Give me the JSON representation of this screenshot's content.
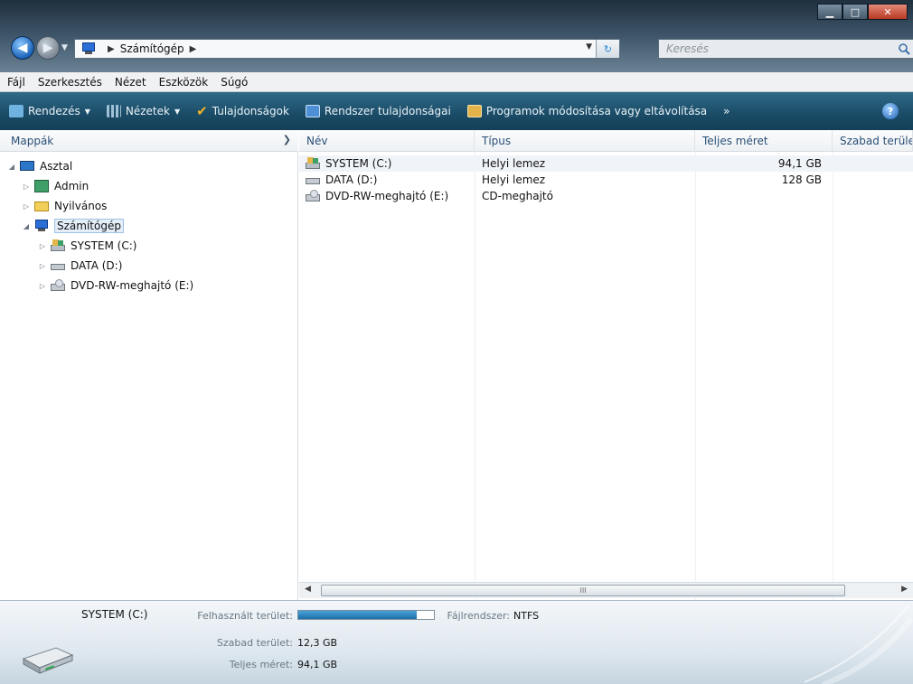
{
  "window": {
    "caption_min": "▁",
    "caption_max": "□",
    "caption_close": "✕"
  },
  "nav": {
    "back": "◀",
    "forward": "▶",
    "address_segments": [
      "Számítógép"
    ],
    "search_placeholder": "Keresés"
  },
  "menu": [
    "Fájl",
    "Szerkesztés",
    "Nézet",
    "Eszközök",
    "Súgó"
  ],
  "commands": [
    {
      "label": "Rendezés",
      "icon": "organize-icon",
      "color": "#6fb3e0",
      "dropdown": true
    },
    {
      "label": "Nézetek",
      "icon": "views-icon",
      "color": "#9fc0d6",
      "dropdown": true
    },
    {
      "label": "Tulajdonságok",
      "icon": "check-icon",
      "color": "#f2b428",
      "dropdown": false
    },
    {
      "label": "Rendszer tulajdonságai",
      "icon": "system-properties-icon",
      "color": "#4f8fd6",
      "dropdown": false
    },
    {
      "label": "Programok módosítása vagy eltávolítása",
      "icon": "programs-icon",
      "color": "#e4b24a",
      "dropdown": false
    }
  ],
  "more_chevron": "»",
  "help": "?",
  "navpane": {
    "title": "Mappák",
    "items": [
      {
        "label": "Asztal",
        "icon": "desktop-icon",
        "arrow": "◢",
        "level": 0
      },
      {
        "label": "Admin",
        "icon": "user-folder-icon",
        "arrow": "▷",
        "level": 1
      },
      {
        "label": "Nyilvános",
        "icon": "folder-icon",
        "arrow": "▷",
        "level": 1
      },
      {
        "label": "Számítógép",
        "icon": "computer-icon",
        "arrow": "◢",
        "level": 1,
        "selected": true
      },
      {
        "label": "SYSTEM (C:)",
        "icon": "system-drive-icon",
        "arrow": "▷",
        "level": 2
      },
      {
        "label": "DATA (D:)",
        "icon": "hard-drive-icon",
        "arrow": "▷",
        "level": 2
      },
      {
        "label": "DVD-RW-meghajtó (E:)",
        "icon": "dvd-drive-icon",
        "arrow": "▷",
        "level": 2
      }
    ]
  },
  "list": {
    "columns": [
      "Név",
      "Típus",
      "Teljes méret",
      "Szabad terüle"
    ],
    "rows": [
      {
        "name": "SYSTEM (C:)",
        "type": "Helyi lemez",
        "total": "94,1 GB",
        "free": "",
        "icon": "system-drive-icon",
        "selected": true
      },
      {
        "name": "DATA (D:)",
        "type": "Helyi lemez",
        "total": "128 GB",
        "free": "",
        "icon": "hard-drive-icon"
      },
      {
        "name": "DVD-RW-meghajtó (E:)",
        "type": "CD-meghajtó",
        "total": "",
        "free": "",
        "icon": "dvd-drive-icon"
      }
    ],
    "scroll_left": "◀",
    "scroll_right": "▶",
    "scroll_grip": "III"
  },
  "details": {
    "title": "SYSTEM (C:)",
    "used_label": "Felhasznált terület:",
    "used_fraction": 0.87,
    "fs_label": "Fájlrendszer:",
    "fs_value": "NTFS",
    "free_label": "Szabad terület:",
    "free_value": "12,3 GB",
    "total_label": "Teljes méret:",
    "total_value": "94,1 GB"
  }
}
